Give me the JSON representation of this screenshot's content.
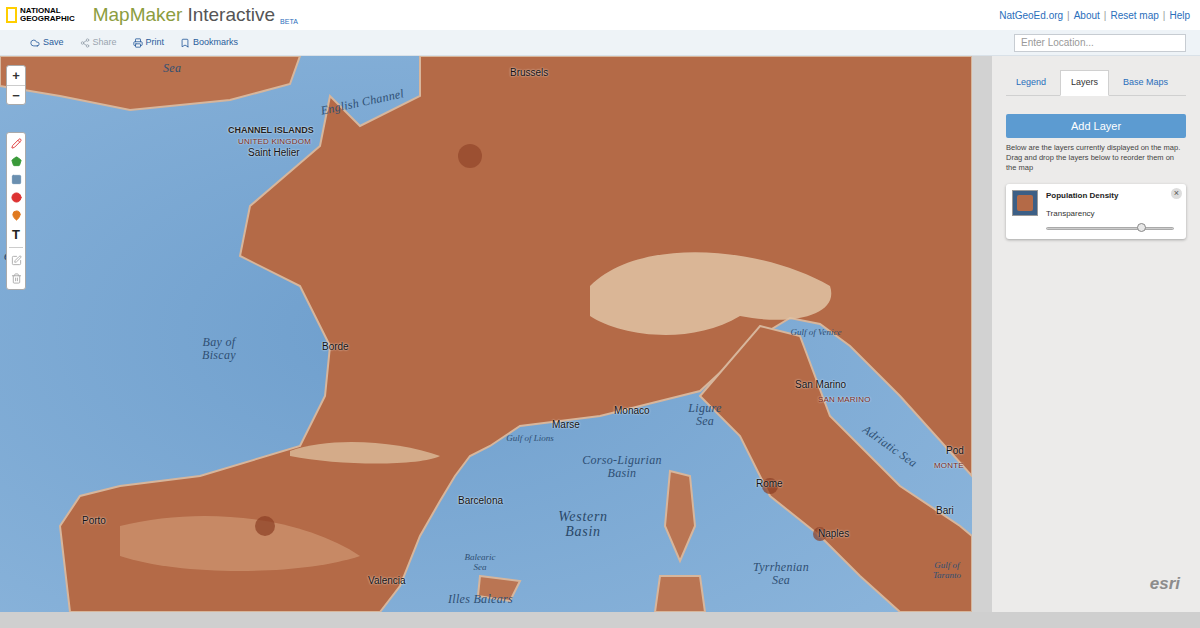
{
  "header": {
    "logo": [
      "NATIONAL",
      "GEOGRAPHIC"
    ],
    "title": "MapMaker",
    "subtitle": "Interactive",
    "badge": "BETA",
    "links": [
      "NatGeoEd.org",
      "About",
      "Reset map",
      "Help"
    ],
    "separator": "|"
  },
  "toolbar": {
    "buttons": [
      {
        "label": "Save",
        "disabled": false
      },
      {
        "label": "Share",
        "disabled": true
      },
      {
        "label": "Print",
        "disabled": false
      },
      {
        "label": "Bookmarks",
        "disabled": false
      }
    ],
    "search": {
      "placeholder": "Enter Location..."
    }
  },
  "map": {
    "zoom": [
      "+",
      "−"
    ],
    "text_tool": "T",
    "attribution": "esri",
    "labels": [
      {
        "text": "Sea",
        "kind": "water"
      },
      {
        "text": "English Channel",
        "kind": "water"
      },
      {
        "text": "CHANNEL ISLANDS",
        "kind": "region"
      },
      {
        "text": "UNITED KINGDOM",
        "kind": "country"
      },
      {
        "text": "Saint Helier",
        "kind": "city"
      },
      {
        "text": "Brussels",
        "kind": "city"
      },
      {
        "text": "ean",
        "kind": "water-lg"
      },
      {
        "text": "Bay of Biscay",
        "kind": "water"
      },
      {
        "text": "Borde",
        "kind": "city"
      },
      {
        "text": "Monaco",
        "kind": "city"
      },
      {
        "text": "Ligure Sea",
        "kind": "water"
      },
      {
        "text": "Gulf of Venice",
        "kind": "water-sm"
      },
      {
        "text": "San Marino",
        "kind": "city"
      },
      {
        "text": "SAN MARINO",
        "kind": "country"
      },
      {
        "text": "Adriatic Sea",
        "kind": "water"
      },
      {
        "text": "Pod",
        "kind": "city"
      },
      {
        "text": "MONTE",
        "kind": "country"
      },
      {
        "text": "Gulf of Lions",
        "kind": "water-sm"
      },
      {
        "text": "Marse",
        "kind": "city"
      },
      {
        "text": "Corso-Ligurian Basin",
        "kind": "water"
      },
      {
        "text": "Western Basin",
        "kind": "water-lg"
      },
      {
        "text": "Barcelona",
        "kind": "city"
      },
      {
        "text": "Porto",
        "kind": "city"
      },
      {
        "text": "Balearic Sea",
        "kind": "water-sm"
      },
      {
        "text": "Illes Balears",
        "kind": "water"
      },
      {
        "text": "Valencia",
        "kind": "city"
      },
      {
        "text": "Rome",
        "kind": "city"
      },
      {
        "text": "Naples",
        "kind": "city"
      },
      {
        "text": "Bari",
        "kind": "city"
      },
      {
        "text": "Tyrrhenian Sea",
        "kind": "water"
      },
      {
        "text": "Gulf of Taranto",
        "kind": "water-sm"
      }
    ]
  },
  "panel": {
    "tabs": [
      {
        "label": "Legend",
        "selected": false
      },
      {
        "label": "Layers",
        "selected": true
      },
      {
        "label": "Base Maps",
        "selected": false
      }
    ],
    "add_layer": "Add Layer",
    "help": "Below are the layers currently displayed on the map. Drag and drop the layers below to reorder them on the map",
    "layers": [
      {
        "name": "Population Density",
        "transparency_label": "Transparency",
        "level": 0.74,
        "close": "×"
      }
    ]
  }
}
